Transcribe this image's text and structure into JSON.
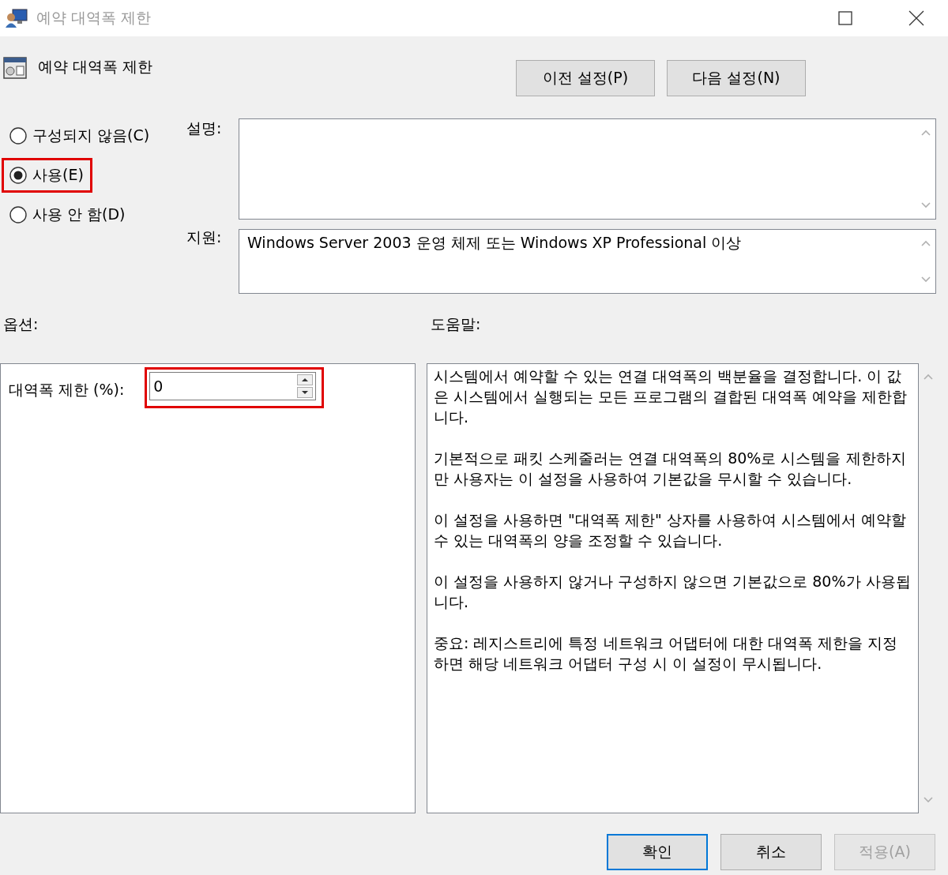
{
  "window": {
    "title": "예약 대역폭 제한"
  },
  "policy_title": "예약 대역폭 제한",
  "nav_buttons": [
    "이전 설정(P)",
    "다음 설정(N)"
  ],
  "state_options": [
    {
      "label": "구성되지 않음(C)",
      "selected": false,
      "highlighted": false
    },
    {
      "label": "사용(E)",
      "selected": true,
      "highlighted": true
    },
    {
      "label": "사용 안 함(D)",
      "selected": false,
      "highlighted": false
    }
  ],
  "description": {
    "label": "설명:"
  },
  "supported_on": {
    "label": "지원:",
    "value": "Windows Server 2003 운영 체제 또는 Windows XP Professional 이상"
  },
  "options": {
    "label": "옵션:",
    "field_label": "대역폭 제한 (%):",
    "value": "0",
    "highlighted": true
  },
  "help": {
    "label": "도움말:",
    "paragraphs": [
      "시스템에서 예약할 수 있는 연결 대역폭의 백분율을 결정합니다. 이 값은 시스템에서 실행되는 모든 프로그램의 결합된 대역폭 예약을 제한합니다.",
      "기본적으로 패킷 스케줄러는 연결 대역폭의 80%로 시스템을 제한하지만 사용자는 이 설정을 사용하여 기본값을 무시할 수 있습니다.",
      "이 설정을 사용하면 \"대역폭 제한\" 상자를 사용하여 시스템에서 예약할 수 있는 대역폭의 양을 조정할 수 있습니다.",
      "이 설정을 사용하지 않거나 구성하지 않으면 기본값으로 80%가 사용됩니다.",
      "중요: 레지스트리에 특정 네트워크 어댑터에 대한 대역폭 제한을 지정하면 해당 네트워크 어댑터 구성 시 이 설정이 무시됩니다."
    ]
  },
  "buttons": [
    {
      "label": "확인",
      "kind": "default",
      "disabled": false
    },
    {
      "label": "취소",
      "kind": "normal",
      "disabled": false
    },
    {
      "label": "적용(A)",
      "kind": "normal",
      "disabled": true
    }
  ]
}
